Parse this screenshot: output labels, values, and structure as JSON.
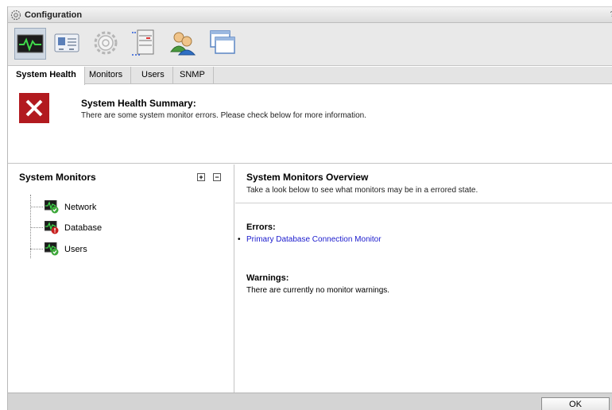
{
  "window": {
    "title": "Configuration",
    "help": "?"
  },
  "toolbar": {
    "tools": [
      {
        "icon": "system-health-icon",
        "active": true
      },
      {
        "icon": "id-card-icon",
        "active": false
      },
      {
        "icon": "gear-icon",
        "active": false
      },
      {
        "icon": "server-icon",
        "active": false
      },
      {
        "icon": "users-icon",
        "active": false
      },
      {
        "icon": "windows-icon",
        "active": false
      }
    ]
  },
  "tabs": [
    {
      "label": "System Health",
      "active": true
    },
    {
      "label": "Monitors",
      "active": false
    },
    {
      "label": "Users",
      "active": false
    },
    {
      "label": "SNMP",
      "active": false
    }
  ],
  "summary": {
    "title": "System Health Summary:",
    "text": "There are some system monitor errors. Please check below for more information.",
    "status_color": "#b21a1f"
  },
  "monitors": {
    "title": "System Monitors",
    "expand": "+",
    "collapse": "−",
    "items": [
      {
        "label": "Network",
        "status": "ok"
      },
      {
        "label": "Database",
        "status": "error"
      },
      {
        "label": "Users",
        "status": "ok"
      }
    ]
  },
  "overview": {
    "title": "System Monitors Overview",
    "subtitle": "Take a look below to see what monitors may be in a errored state.",
    "errors_heading": "Errors:",
    "errors": [
      "Primary Database Connection Monitor"
    ],
    "bullet": "•",
    "warnings_heading": "Warnings:",
    "warnings_text": "There are currently no monitor warnings."
  },
  "footer": {
    "ok_label": "OK"
  }
}
